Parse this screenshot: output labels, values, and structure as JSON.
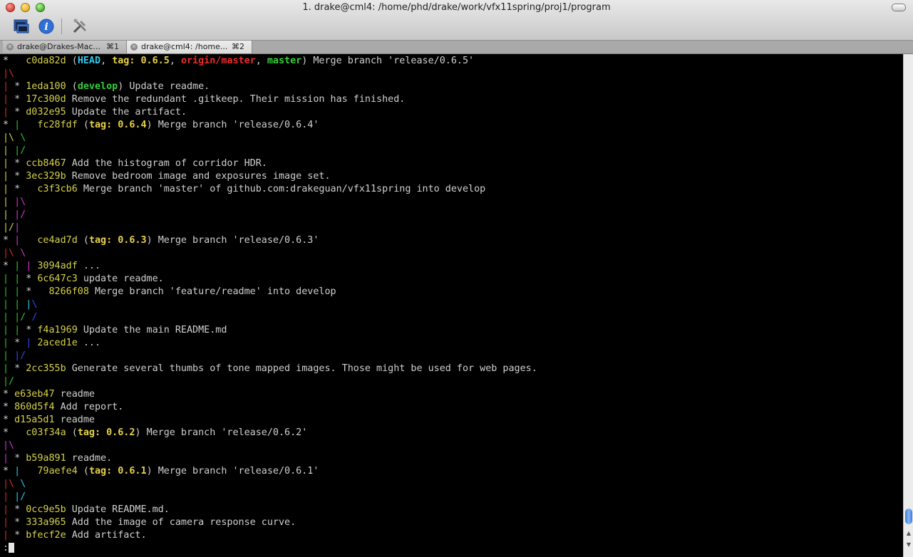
{
  "window": {
    "title": "1. drake@cml4: /home/phd/drake/work/vfx11spring/proj1/program"
  },
  "toolbar": {
    "icons": [
      "new-window-icon",
      "info-icon",
      "tools-icon"
    ]
  },
  "tabs": [
    {
      "label": "drake@Drakes-Mac...",
      "shortcut": "⌘1"
    },
    {
      "label": "drake@cml4: /home...",
      "shortcut": "⌘2"
    }
  ],
  "colors": {
    "hash": "#d7d24a",
    "head": "#35c7e8",
    "tag": "#e8d24a",
    "remote_branch": "#ee2b2b",
    "local_branch": "#35d03a"
  },
  "log": {
    "l0": {
      "hash": "c0da82d",
      "refs_head": "HEAD",
      "tag_label": "tag: ",
      "tag_version": "0.6.5",
      "remote": "origin/master",
      "local": "master",
      "msg": "Merge branch 'release/0.6.5'"
    },
    "l2": {
      "hash": "1eda100",
      "branch": "develop",
      "msg": "Update readme."
    },
    "l3": {
      "hash": "17c300d",
      "msg": "Remove the redundant .gitkeep. Their mission has finished."
    },
    "l4": {
      "hash": "d032e95",
      "msg": "Update the artifact."
    },
    "l5": {
      "hash": "fc28fdf",
      "tag_label": "tag: ",
      "tag_version": "0.6.4",
      "msg": "Merge branch 'release/0.6.4'"
    },
    "l8": {
      "hash": "ccb8467",
      "msg": "Add the histogram of corridor HDR."
    },
    "l9": {
      "hash": "3ec329b",
      "msg": "Remove bedroom image and exposures image set."
    },
    "l10": {
      "hash": "c3f3cb6",
      "msg": "Merge branch 'master' of github.com:drakeguan/vfx11spring into develop"
    },
    "l14": {
      "hash": "ce4ad7d",
      "tag_label": "tag: ",
      "tag_version": "0.6.3",
      "msg": "Merge branch 'release/0.6.3'"
    },
    "l16": {
      "hash": "3094adf",
      "msg": "..."
    },
    "l17": {
      "hash": "6c647c3",
      "msg": "update readme."
    },
    "l18": {
      "hash": "8266f08",
      "msg": "Merge branch 'feature/readme' into develop"
    },
    "l21": {
      "hash": "f4a1969",
      "msg": "Update the main README.md"
    },
    "l22": {
      "hash": "2aced1e",
      "msg": "..."
    },
    "l24": {
      "hash": "2cc355b",
      "msg": "Generate several thumbs of tone mapped images. Those might be used for web pages."
    },
    "l26": {
      "hash": "e63eb47",
      "msg": "readme"
    },
    "l27": {
      "hash": "860d5f4",
      "msg": "Add report."
    },
    "l28": {
      "hash": "d15a5d1",
      "msg": "readme"
    },
    "l29": {
      "hash": "c03f34a",
      "tag_label": "tag: ",
      "tag_version": "0.6.2",
      "msg": "Merge branch 'release/0.6.2'"
    },
    "l31": {
      "hash": "b59a891",
      "msg": "readme."
    },
    "l32": {
      "hash": "79aefe4",
      "tag_label": "tag: ",
      "tag_version": "0.6.1",
      "msg": "Merge branch 'release/0.6.1'"
    },
    "l35": {
      "hash": "0cc9e5b",
      "msg": "Update README.md."
    },
    "l36": {
      "hash": "333a965",
      "msg": "Add the image of camera response curve."
    },
    "l37": {
      "hash": "bfecf2e",
      "msg": "Add artifact."
    }
  },
  "prompt": {
    "text": ":"
  }
}
